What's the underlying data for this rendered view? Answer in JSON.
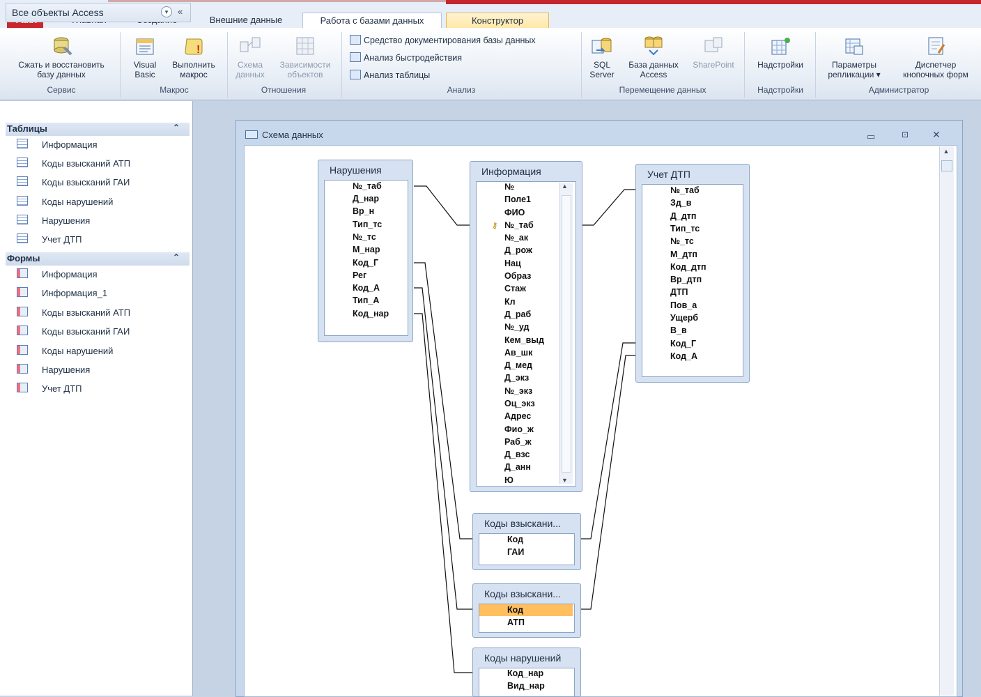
{
  "ribbon_tabs": [
    "Файл",
    "Главная",
    "Создание",
    "Внешние данные",
    "Работа с базами данных",
    "Конструктор"
  ],
  "ribbon": {
    "compact": "Сжать и восстановить\nбазу данных",
    "visual_basic": "Visual\nBasic",
    "run_macro": "Выполнить\nмакрос",
    "schema": "Схема\nданных",
    "dependencies": "Зависимости\nобъектов",
    "documenter": "Средство документирования базы данных",
    "perf": "Анализ быстродействия",
    "table_an": "Анализ таблицы",
    "sql": "SQL\nServer",
    "access_db": "База данных\nAccess",
    "sharepoint": "SharePoint",
    "addins": "Надстройки",
    "replication": "Параметры\nрепликации ▾",
    "switchboard": "Диспетчер\nкнопочных форм",
    "groups": {
      "service": "Сервис",
      "macro": "Макрос",
      "relations": "Отношения",
      "analysis": "Анализ",
      "move": "Перемещение данных",
      "addins": "Надстройки",
      "admin": "Администратор"
    }
  },
  "nav": {
    "header": "Все объекты Access",
    "tables_label": "Таблицы",
    "tables": [
      "Информация",
      "Коды взысканий АТП",
      "Коды взысканий ГАИ",
      "Коды нарушений",
      "Нарушения",
      "Учет ДТП"
    ],
    "forms_label": "Формы",
    "forms": [
      "Информация",
      "Информация_1",
      "Коды взысканий АТП",
      "Коды взысканий ГАИ",
      "Коды нарушений",
      "Нарушения",
      "Учет ДТП"
    ]
  },
  "window_title": "Схема данных",
  "tables": {
    "violations": {
      "title": "Нарушения",
      "fields": [
        "№_таб",
        "Д_нар",
        "Вр_н",
        "Тип_тс",
        "№_тс",
        "М_нар",
        "Код_Г",
        "Рег",
        "Код_А",
        "Тип_А",
        "Код_нар"
      ]
    },
    "info": {
      "title": "Информация",
      "fields": [
        "№",
        "Поле1",
        "ФИО",
        "№_таб",
        "№_ак",
        "Д_рож",
        "Нац",
        "Образ",
        "Стаж",
        "Кл",
        "Д_раб",
        "№_уд",
        "Кем_выд",
        "Ав_шк",
        "Д_мед",
        "Д_экз",
        "№_экз",
        "Оц_экз",
        "Адрес",
        "Фио_ж",
        "Раб_ж",
        "Д_взс",
        "Д_анн",
        "Ю"
      ]
    },
    "dtp": {
      "title": "Учет ДТП",
      "fields": [
        "№_таб",
        "Зд_в",
        "Д_дтп",
        "Тип_тс",
        "№_тс",
        "М_дтп",
        "Код_дтп",
        "Вр_дтп",
        "ДТП",
        "Пов_а",
        "Ущерб",
        "В_в",
        "Код_Г",
        "Код_А"
      ]
    },
    "gai": {
      "title": "Коды взыскани...",
      "fields": [
        "Код",
        "ГАИ"
      ]
    },
    "atp": {
      "title": "Коды взыскани...",
      "fields": [
        "Код",
        "АТП"
      ]
    },
    "codes": {
      "title": "Коды нарушений",
      "fields": [
        "Код_нар",
        "Вид_нар"
      ]
    }
  }
}
